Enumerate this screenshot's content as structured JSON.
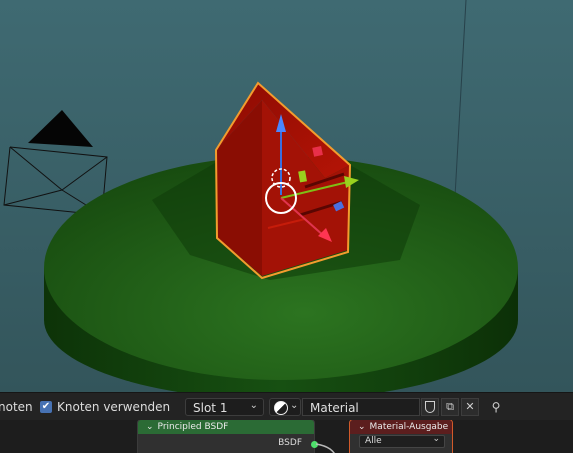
{
  "viewport": {
    "colors": {
      "background": "#3a5f66",
      "ground": "#1d5a14",
      "object": "#9a0f04",
      "outline": "#f39c2e"
    }
  },
  "header": {
    "partial_label": "noten",
    "use_nodes_label": "Knoten verwenden",
    "use_nodes_checked": true,
    "slot_value": "Slot 1",
    "material_name": "Material"
  },
  "nodes": {
    "principled": {
      "title": "Principled BSDF",
      "output_label": "BSDF"
    },
    "output": {
      "title": "Material-Ausgabe",
      "target_value": "Alle"
    }
  }
}
